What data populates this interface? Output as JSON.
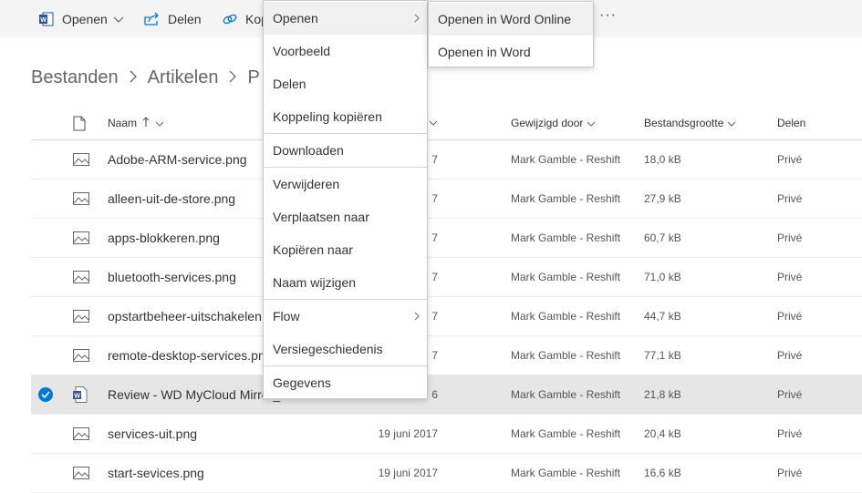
{
  "toolbar": {
    "open_label": "Openen",
    "share_label": "Delen",
    "copy_label": "Kop",
    "more_label": "···"
  },
  "breadcrumb": [
    "Bestanden",
    "Artikelen",
    "P"
  ],
  "columns": {
    "name": "Naam",
    "modified_by": "Gewijzigd door",
    "size": "Bestandsgrootte",
    "sharing": "Delen"
  },
  "files": [
    {
      "name": "Adobe-ARM-service.png",
      "modified": "7",
      "by": "Mark Gamble - Reshift",
      "size": "18,0 kB",
      "sharing": "Privé",
      "type": "image"
    },
    {
      "name": "alleen-uit-de-store.png",
      "modified": "7",
      "by": "Mark Gamble - Reshift",
      "size": "27,9 kB",
      "sharing": "Privé",
      "type": "image"
    },
    {
      "name": "apps-blokkeren.png",
      "modified": "7",
      "by": "Mark Gamble - Reshift",
      "size": "60,7 kB",
      "sharing": "Privé",
      "type": "image"
    },
    {
      "name": "bluetooth-services.png",
      "modified": "7",
      "by": "Mark Gamble - Reshift",
      "size": "71,0 kB",
      "sharing": "Privé",
      "type": "image"
    },
    {
      "name": "opstartbeheer-uitschakelen",
      "modified": "7",
      "by": "Mark Gamble - Reshift",
      "size": "44,7 kB",
      "sharing": "Privé",
      "type": "image"
    },
    {
      "name": "remote-desktop-services.pn",
      "modified": "7",
      "by": "Mark Gamble - Reshift",
      "size": "77,1 kB",
      "sharing": "Privé",
      "type": "image"
    },
    {
      "name": "Review - WD MyCloud Mirror_",
      "modified": "6",
      "by": "Mark Gamble - Reshift",
      "size": "21,8 kB",
      "sharing": "Privé",
      "type": "word",
      "selected": true
    },
    {
      "name": "services-uit.png",
      "modified": "19 juni 2017",
      "by": "Mark Gamble - Reshift",
      "size": "20,4 kB",
      "sharing": "Privé",
      "type": "image"
    },
    {
      "name": "start-sevices.png",
      "modified": "19 juni 2017",
      "by": "Mark Gamble - Reshift",
      "size": "16,6 kB",
      "sharing": "Privé",
      "type": "image"
    }
  ],
  "context_menu": {
    "items": [
      "Openen",
      "Voorbeeld",
      "Delen",
      "Koppeling kopiëren",
      "Downloaden",
      "Verwijderen",
      "Verplaatsen naar",
      "Kopiëren naar",
      "Naam wijzigen",
      "Flow",
      "Versiegeschiedenis",
      "Gegevens"
    ]
  },
  "submenu": {
    "items": [
      "Openen in Word Online",
      "Openen in Word"
    ]
  },
  "colors": {
    "accent": "#0078d7",
    "word": "#2b579a",
    "toolbar_bg": "#f4f4f4",
    "selected_row": "#e6e6e6"
  }
}
